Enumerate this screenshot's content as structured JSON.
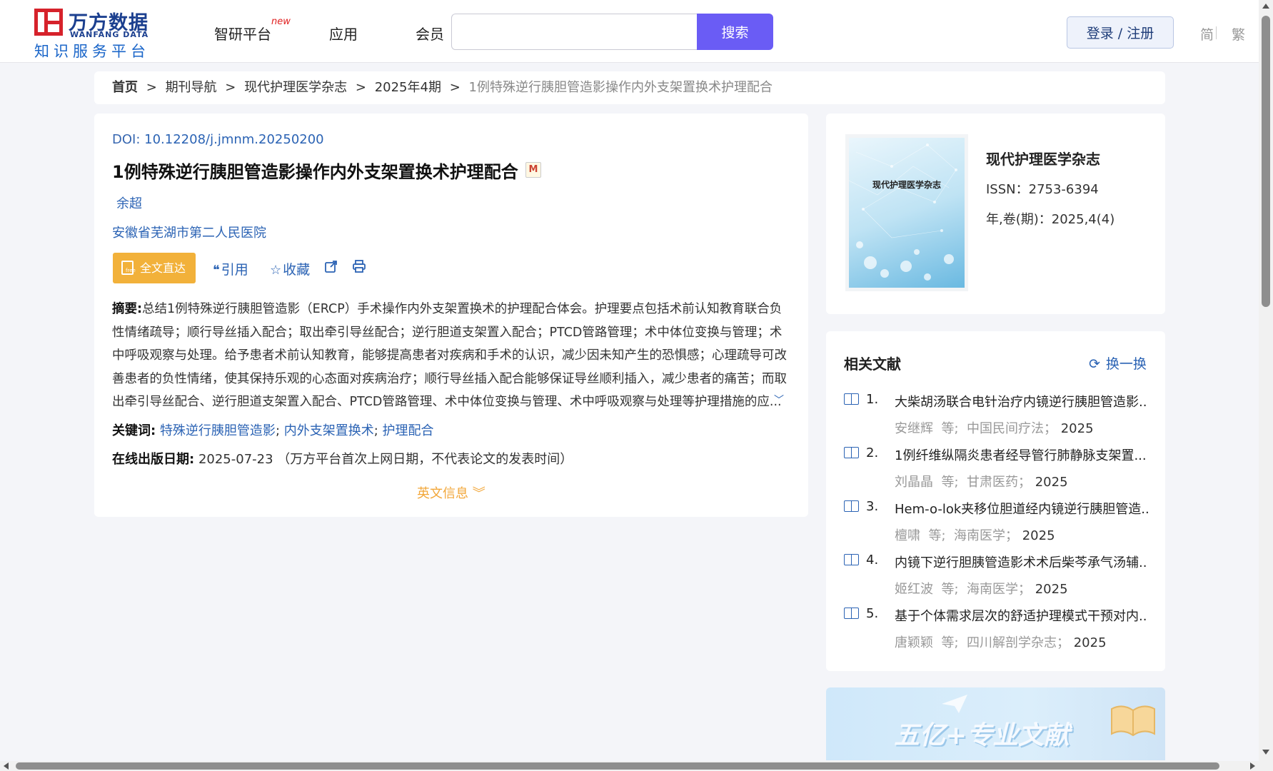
{
  "header": {
    "logo_cn": "万方数据",
    "logo_en": "WANFANG DATA",
    "logo_sub": "知识服务平台",
    "nav": [
      {
        "label": "智研平台",
        "badge": "new"
      },
      {
        "label": "应用"
      },
      {
        "label": "会员"
      }
    ],
    "search_value": "",
    "search_button": "搜索",
    "login_button": "登录 / 注册",
    "lang_simplified": "简",
    "lang_traditional": "繁"
  },
  "breadcrumb": {
    "home": "首页",
    "items": [
      "期刊导航",
      "现代护理医学杂志",
      "2025年4期"
    ],
    "current": "1例特殊逆行胰胆管造影操作内外支架置换术护理配合",
    "separator": ">"
  },
  "article": {
    "doi_label": "DOI:",
    "doi": "10.12208/j.jmnm.20250200",
    "title": "1例特殊逆行胰胆管造影操作内外支架置换术护理配合",
    "title_badge": "M",
    "author": "余超",
    "affiliation": "安徽省芜湖市第二人民医院",
    "actions": {
      "fulltext": "全文直达",
      "cite": "引用",
      "favorite": "收藏"
    },
    "abstract_label": "摘要:",
    "abstract": "总结1例特殊逆行胰胆管造影（ERCP）手术操作内外支架置换术的护理配合体会。护理要点包括术前认知教育联合负性情绪疏导；顺行导丝插入配合；取出牵引导丝配合；逆行胆道支架置入配合；PTCD管路管理；术中体位变换与管理；术中呼吸观察与处理。给予患者术前认知教育，能够提高患者对疾病和手术的认识，减少因未知产生的恐惧感；心理疏导可改善患者的负性情绪，使其保持乐观的心态面对疾病治疗；顺行导丝插入配合能够保证导丝顺利插入，减少患者的痛苦；而取出牵引导丝配合、逆行胆道支架置入配合、PTCD管路管理、术中体位变换与管理、术中呼吸观察与处理等护理措施的应...",
    "keywords_label": "关键词:",
    "keywords": [
      "特殊逆行胰胆管造影",
      "内外支架置换术",
      "护理配合"
    ],
    "pubdate_label": "在线出版日期:",
    "pubdate": "2025-07-23",
    "pubdate_note": "（万方平台首次上网日期，不代表论文的发表时间）",
    "en_info": "英文信息"
  },
  "journal": {
    "cover_title": "现代护理医学杂志",
    "name": "现代护理医学杂志",
    "issn": "ISSN：2753-6394",
    "volume": "年,卷(期)：2025,4(4)"
  },
  "related": {
    "title": "相关文献",
    "refresh": "换一换",
    "items": [
      {
        "num": "1.",
        "title": "大柴胡汤联合电针治疗内镜逆行胰胆管造影...",
        "authors": "安继辉",
        "etal": "等;",
        "source": "中国民间疗法；",
        "year": "2025"
      },
      {
        "num": "2.",
        "title": "1例纤维纵隔炎患者经导管行肺静脉支架置...",
        "authors": "刘晶晶",
        "etal": "等;",
        "source": "甘肃医药；",
        "year": "2025"
      },
      {
        "num": "3.",
        "title": "Hem-o-lok夹移位胆道经内镜逆行胰胆管造...",
        "authors": "檀啸",
        "etal": "等;",
        "source": "海南医学；",
        "year": "2025"
      },
      {
        "num": "4.",
        "title": "内镜下逆行胆胰管造影术术后柴芩承气汤辅...",
        "authors": "姬红波",
        "etal": "等;",
        "source": "海南医学；",
        "year": "2025"
      },
      {
        "num": "5.",
        "title": "基于个体需求层次的舒适护理模式干预对内...",
        "authors": "唐颖颖",
        "etal": "等;",
        "source": "四川解剖学杂志；",
        "year": "2025"
      }
    ]
  },
  "banner": {
    "text": "五亿+专业文献"
  },
  "colors": {
    "primary_blue": "#2b63b4",
    "search_purple": "#6a5cf5",
    "fulltext_orange": "#f2b13a",
    "logo_red": "#d6222b"
  }
}
